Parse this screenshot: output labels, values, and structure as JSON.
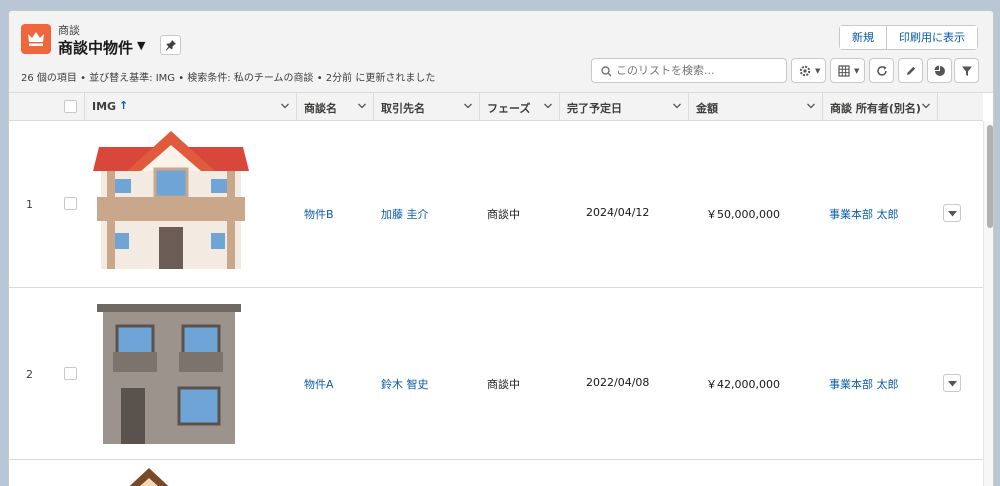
{
  "object": {
    "label": "商談",
    "icon": "crown-icon",
    "color": "#f0663c"
  },
  "list_view": {
    "title": "商談中物件",
    "meta": "26 個の項目 • 並び替え基準: IMG • 検索条件: 私のチームの商談 • 2分前 に更新されました"
  },
  "actions": {
    "new_label": "新規",
    "print_label": "印刷用に表示"
  },
  "search": {
    "placeholder": "このリストを検索..."
  },
  "toolbar": [
    "gear-icon",
    "table-icon",
    "refresh-icon",
    "pencil-icon",
    "pie-chart-icon",
    "filter-icon"
  ],
  "columns": {
    "img": "IMG",
    "name": "商談名",
    "account": "取引先名",
    "phase": "フェーズ",
    "close_date": "完了予定日",
    "amount": "金額",
    "owner": "商談 所有者(別名)"
  },
  "sort_indicator": "↑",
  "rows": [
    {
      "num": "1",
      "image": "two-story-house-red-roof",
      "name": "物件B",
      "account": "加藤 圭介",
      "phase": "商談中",
      "close_date": "2024/04/12",
      "amount": "￥50,000,000",
      "owner": "事業本部 太郎"
    },
    {
      "num": "2",
      "image": "modern-gray-house",
      "name": "物件A",
      "account": "鈴木 智史",
      "phase": "商談中",
      "close_date": "2022/04/08",
      "amount": "￥42,000,000",
      "owner": "事業本部 太郎"
    },
    {
      "num": "",
      "image": "brown-roof-house"
    }
  ],
  "colors": {
    "link": "#0b5cab",
    "header_bg": "#f3f3f3",
    "border": "#dddbda",
    "background": "#b9c6d6"
  }
}
